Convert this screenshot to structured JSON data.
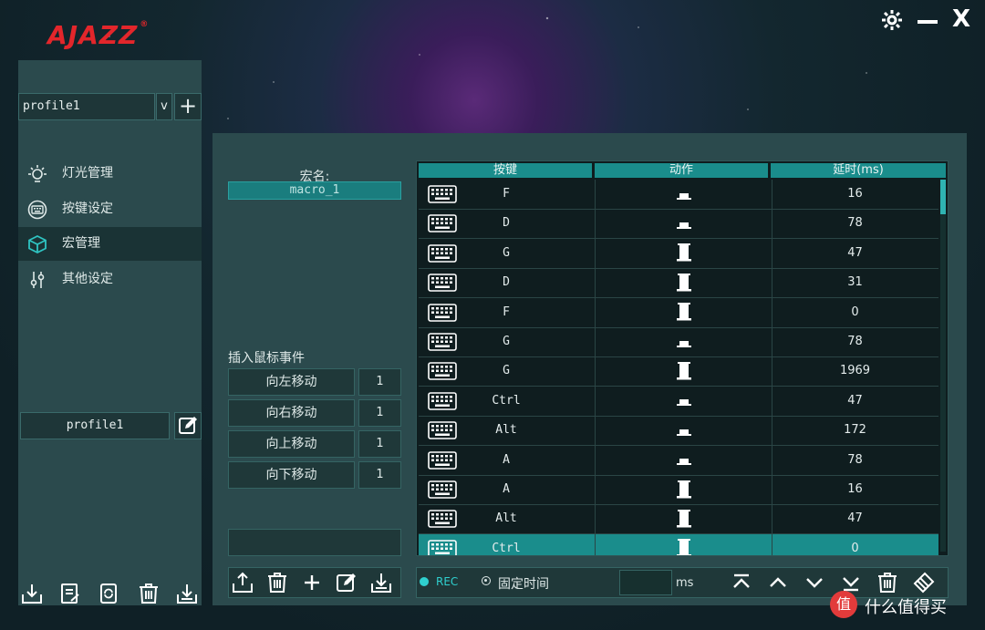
{
  "brand": {
    "logo": "AJAZZ",
    "reg": "®"
  },
  "window": {
    "settings_icon": "gear-icon",
    "minimize_icon": "minimize-icon",
    "close_icon": "close-icon",
    "close_glyph": "X"
  },
  "sidebar": {
    "profile_select": "profile1",
    "dropdown_glyph": "v",
    "add_glyph": "+",
    "nav": [
      {
        "label": "灯光管理",
        "icon": "bulb-icon"
      },
      {
        "label": "按键设定",
        "icon": "keyboard-icon"
      },
      {
        "label": "宏管理",
        "icon": "cube-icon"
      },
      {
        "label": "其他设定",
        "icon": "sliders-icon"
      }
    ],
    "profile_name": "profile1",
    "bottom_icons": [
      "import-icon",
      "export-doc-icon",
      "refresh-icon",
      "delete-icon",
      "download-icon"
    ]
  },
  "macro": {
    "name_label": "宏名:",
    "name_value": "macro_1",
    "mouse_events_label": "插入鼠标事件",
    "moves": [
      {
        "label": "向左移动",
        "value": "1"
      },
      {
        "label": "向右移动",
        "value": "1"
      },
      {
        "label": "向上移动",
        "value": "1"
      },
      {
        "label": "向下移动",
        "value": "1"
      }
    ],
    "toolbar_icons": [
      "import-icon",
      "delete-icon",
      "add-icon",
      "edit-icon",
      "download-icon"
    ],
    "table": {
      "headers": [
        "按键",
        "动作",
        "延时(ms)"
      ],
      "rows": [
        {
          "key": "F",
          "action": "up",
          "delay": "16"
        },
        {
          "key": "D",
          "action": "up",
          "delay": "78"
        },
        {
          "key": "G",
          "action": "down",
          "delay": "47"
        },
        {
          "key": "D",
          "action": "down",
          "delay": "31"
        },
        {
          "key": "F",
          "action": "down",
          "delay": "0"
        },
        {
          "key": "G",
          "action": "up",
          "delay": "78"
        },
        {
          "key": "G",
          "action": "down",
          "delay": "1969"
        },
        {
          "key": "Ctrl",
          "action": "up",
          "delay": "47"
        },
        {
          "key": "Alt",
          "action": "up",
          "delay": "172"
        },
        {
          "key": "A",
          "action": "up",
          "delay": "78"
        },
        {
          "key": "A",
          "action": "down",
          "delay": "16"
        },
        {
          "key": "Alt",
          "action": "down",
          "delay": "47"
        },
        {
          "key": "Ctrl",
          "action": "down",
          "delay": "0",
          "selected": true
        }
      ]
    },
    "rec_label": "REC",
    "fixed_time_label": "固定时间",
    "ms_label": "ms",
    "ms_value": "",
    "nav_icons": [
      "move-top-icon",
      "move-up-icon",
      "move-down-icon",
      "move-bottom-icon",
      "delete-icon",
      "clear-icon"
    ]
  },
  "watermark": {
    "text": "值 什么值得买"
  }
}
